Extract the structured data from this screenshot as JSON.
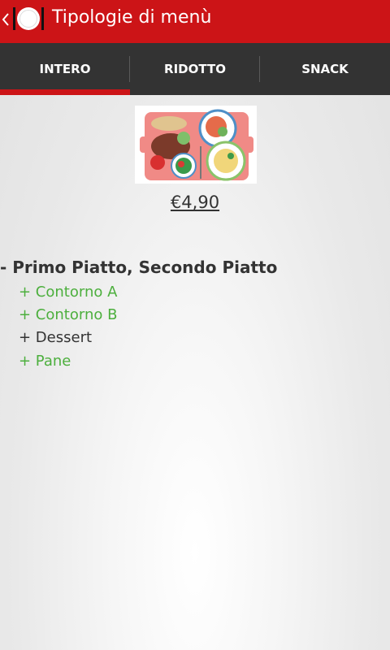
{
  "actionbar": {
    "title": "Tipologie di menù",
    "up_icon": "chevron-left-icon",
    "app_icon": "plate-fork-icon",
    "color": "#cc1417"
  },
  "tabs": [
    {
      "label": "INTERO",
      "selected": true
    },
    {
      "label": "RIDOTTO",
      "selected": false
    },
    {
      "label": "SNACK",
      "selected": false
    }
  ],
  "menu": {
    "image": "meal-tray-image",
    "price": "€4,90",
    "course": "- Primo Piatto, Secondo Piatto",
    "items": [
      {
        "text": "+ Contorno A",
        "color": "#4caf3d"
      },
      {
        "text": "+ Contorno B",
        "color": "#4caf3d"
      },
      {
        "text": "+ Dessert",
        "color": "#333333"
      },
      {
        "text": "+ Pane",
        "color": "#4caf3d"
      }
    ]
  }
}
